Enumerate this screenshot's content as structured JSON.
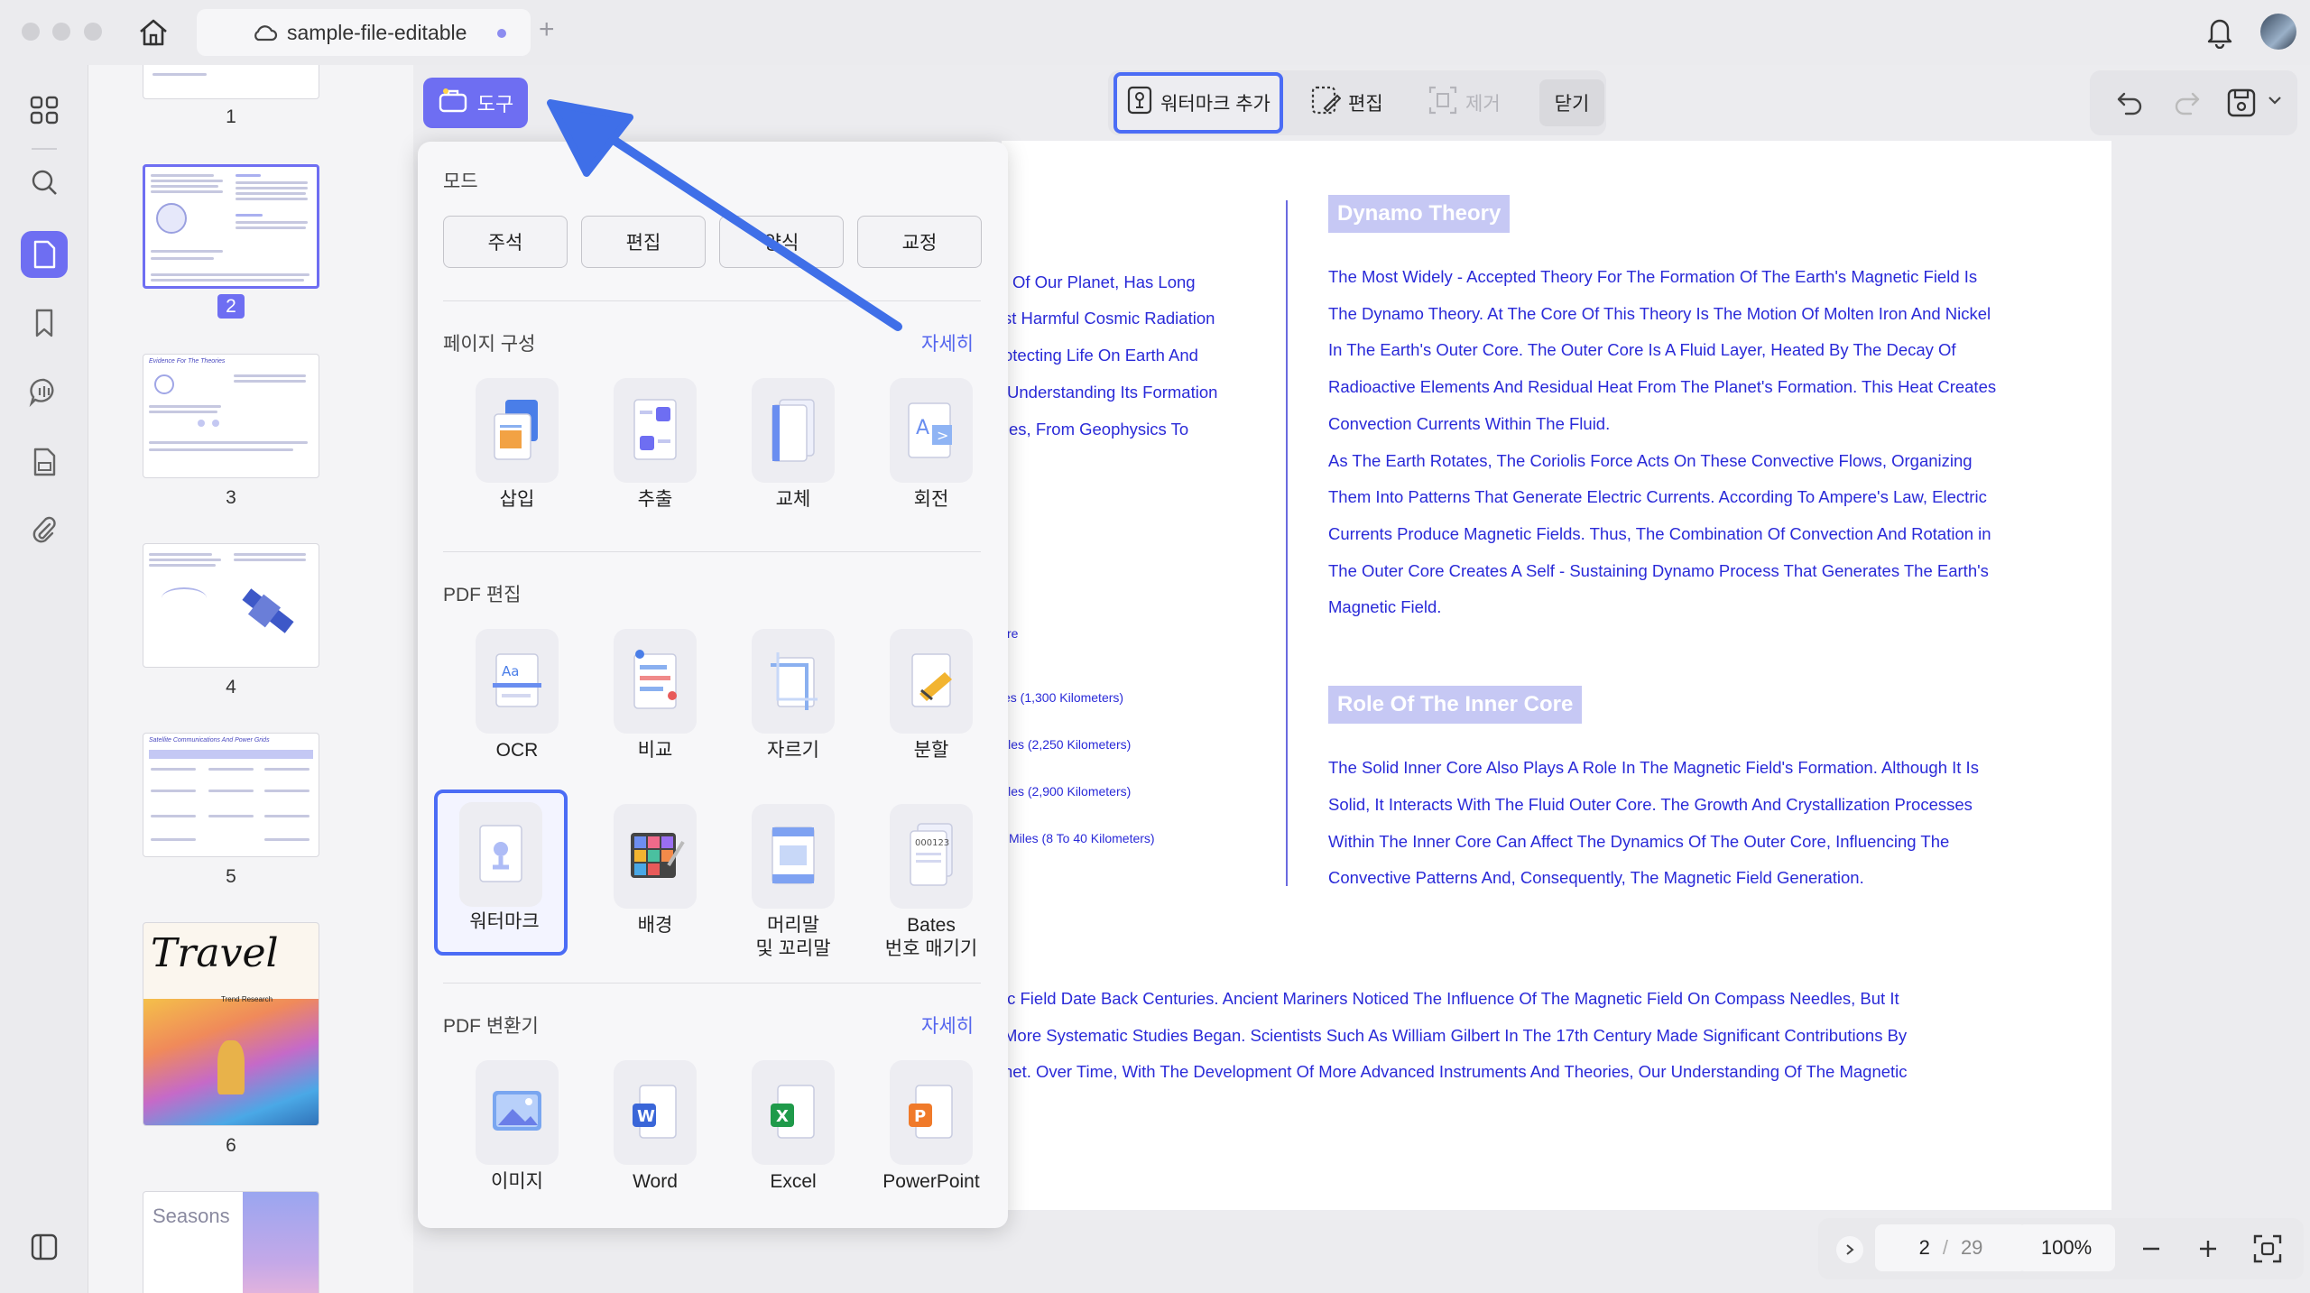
{
  "window": {
    "tab_title": "sample-file-editable",
    "new_tab": "+"
  },
  "sidebar_icons": [
    "apps-icon",
    "search-icon",
    "pages-icon",
    "bookmark-icon",
    "comment-icon",
    "form-icon",
    "attachment-icon"
  ],
  "thumbnails": {
    "labels": [
      "1",
      "2",
      "3",
      "4",
      "5",
      "6"
    ],
    "page3_title": "Evidence For The Theories",
    "page5_title": "Satellite Communications And Power Grids",
    "page6_title": "Travel",
    "page6_sub": "Trend Research",
    "page7_title": "Seasons"
  },
  "toolbar": {
    "tools_label": "도구",
    "watermark_add": "워터마크 추가",
    "edit": "편집",
    "remove": "제거",
    "close": "닫기"
  },
  "tools_panel": {
    "mode_title": "모드",
    "modes": [
      "주석",
      "편집",
      "양식",
      "교정"
    ],
    "page_org_title": "페이지 구성",
    "page_org_more": "자세히",
    "page_org": [
      "삽입",
      "추출",
      "교체",
      "회전"
    ],
    "pdf_edit_title": "PDF 편집",
    "pdf_edit_row1": [
      "OCR",
      "비교",
      "자르기",
      "분할"
    ],
    "pdf_edit_row2": [
      "워터마크",
      "배경",
      "머리말\n및 꼬리말",
      "Bates\n번호 매기기"
    ],
    "converter_title": "PDF 변환기",
    "converter_more": "자세히",
    "converter": [
      "이미지",
      "Word",
      "Excel",
      "PowerPoint"
    ]
  },
  "document": {
    "left_col": [
      "Of Our Planet, Has Long",
      "st Harmful Cosmic Radiation",
      "otecting Life On Earth And",
      " Understanding Its Formation",
      "es, From Geophysics To"
    ],
    "left_small": [
      "re",
      "es (1,300 Kilometers)",
      "iles (2,250 Kilometers)",
      "iles (2,900 Kilometers)",
      "Miles (8 To 40 Kilometers)"
    ],
    "heading1": "Dynamo Theory",
    "para1": [
      "The Most Widely - Accepted Theory For The Formation Of The Earth's Magnetic Field Is",
      "The Dynamo Theory. At The Core Of This Theory Is The Motion Of Molten Iron And Nickel",
      "In The Earth's Outer Core. The Outer Core Is A Fluid Layer, Heated By The Decay Of",
      "Radioactive Elements And Residual Heat From The Planet's Formation. This Heat Creates",
      "Convection Currents Within The Fluid.",
      "As The Earth Rotates, The Coriolis Force Acts On These Convective Flows, Organizing",
      "Them Into Patterns That Generate Electric Currents. According To Ampere's Law, Electric",
      "Currents Produce Magnetic Fields. Thus, The Combination Of Convection And Rotation in",
      "The Outer Core Creates A Self - Sustaining Dynamo Process That Generates The Earth's",
      "Magnetic Field."
    ],
    "heading2": "Role Of The Inner Core",
    "para2": [
      "The Solid Inner Core Also Plays A Role In The Magnetic Field's Formation. Although It Is",
      "Solid, It Interacts With The Fluid Outer Core. The Growth And Crystallization Processes",
      "Within The Inner Core Can Affect The Dynamics Of The Outer Core, Influencing The",
      "Convective Patterns And, Consequently, The Magnetic Field Generation."
    ],
    "para3": [
      "ic Field Date Back Centuries. Ancient Mariners Noticed The Influence Of The Magnetic Field On Compass Needles, But It",
      "More Systematic Studies Began. Scientists Such As William Gilbert In The 17th Century Made Significant Contributions By",
      "net. Over Time, With The Development Of More Advanced Instruments And Theories, Our Understanding Of The Magnetic"
    ]
  },
  "footer": {
    "current_page": "2",
    "separator": "/",
    "total_pages": "29",
    "zoom": "100%"
  },
  "colors": {
    "accent": "#6e6ef2",
    "highlight_border": "#4b6cf5",
    "doc_text": "#2a2ad8",
    "heading_bg": "#c6c8f4"
  }
}
